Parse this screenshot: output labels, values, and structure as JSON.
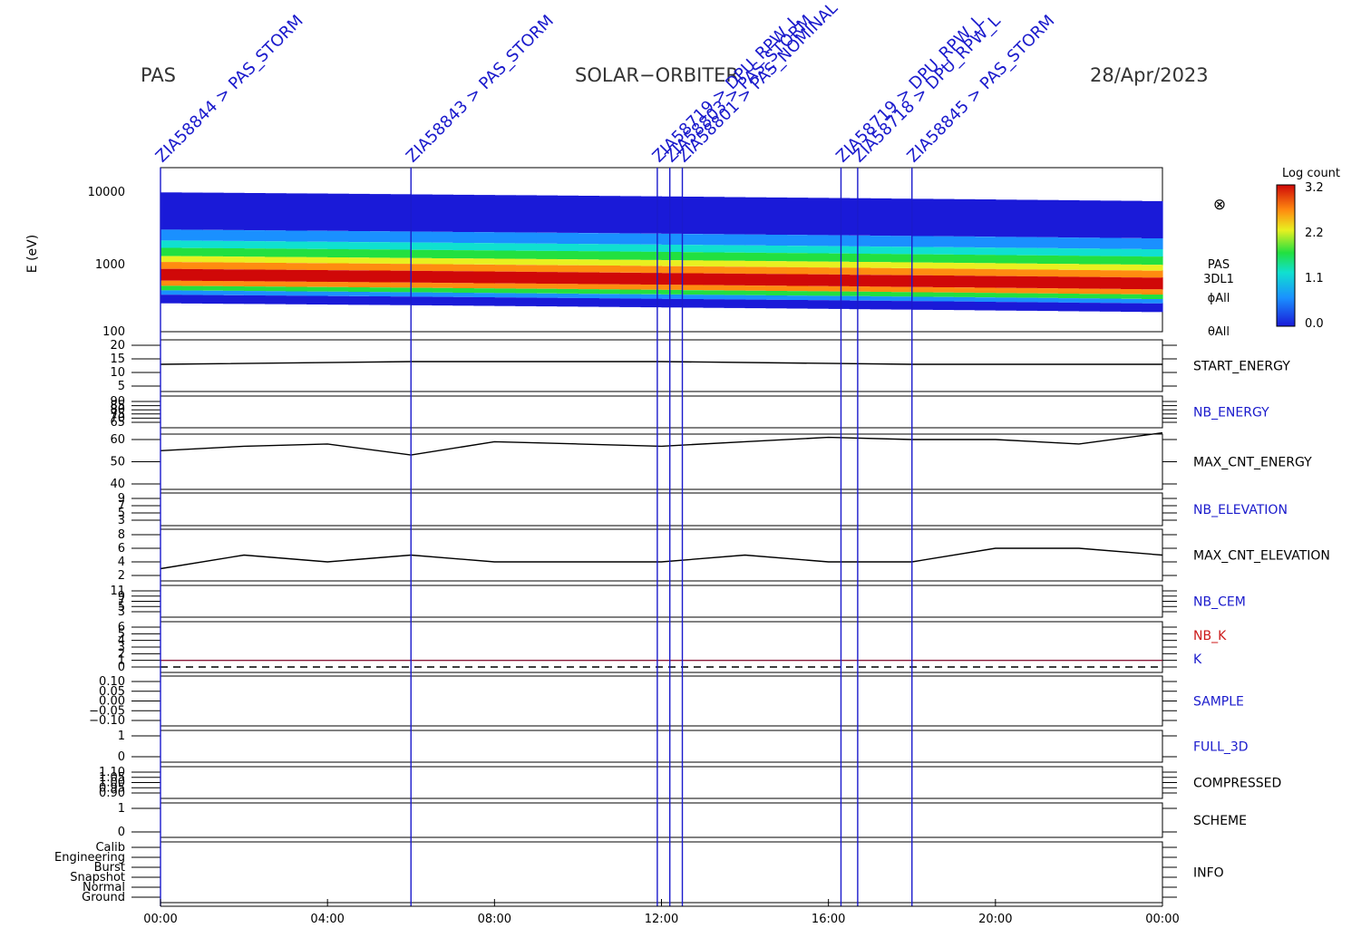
{
  "header": {
    "left": "PAS",
    "center": "SOLAR−ORBITER",
    "right": "28/Apr/2023"
  },
  "colors": {
    "event_line": "#1a1acc",
    "panel_label_blue": "#1a1acc",
    "panel_label_red": "#cc1a1a",
    "k_line": "#8b1a3a"
  },
  "time_axis": {
    "range_hours": [
      0,
      24
    ],
    "ticks": [
      "00:00",
      "04:00",
      "08:00",
      "12:00",
      "16:00",
      "20:00",
      "00:00"
    ]
  },
  "events": {
    "label_prefix": "ZIA58",
    "lines": [
      {
        "t": 0.0,
        "label": "ZIA58844 > PAS_STORM"
      },
      {
        "t": 6.0,
        "label": "ZIA58843 > PAS_STORM"
      },
      {
        "t": 11.9,
        "label": "ZIA58719 > DPU_RPW_L"
      },
      {
        "t": 12.2,
        "label": "ZIA58803 > PAS_STORM"
      },
      {
        "t": 12.5,
        "label": "ZIA58801 > PAS_NOMINAL"
      },
      {
        "t": 16.3,
        "label": "ZIA58719 > DPU_RPW_L"
      },
      {
        "t": 16.7,
        "label": "ZIA58718 > DPU_RPW_L"
      },
      {
        "t": 18.0,
        "label": "ZIA58845 > PAS_STORM"
      }
    ]
  },
  "spectrogram": {
    "ylabel": "E (eV)",
    "yticks": [
      "10000",
      "1000",
      "100"
    ],
    "colorbar": {
      "title": "Log count",
      "ticks": [
        "3.2",
        "2.2",
        "1.1",
        "0.0"
      ]
    },
    "side_labels": [
      "PAS",
      "3DL1",
      "ϕAll",
      "θAll"
    ],
    "symbol": "⊗"
  },
  "panels": [
    {
      "name": "START_ENERGY",
      "color": "black",
      "yticks": [
        "20",
        "15",
        "10",
        "5"
      ]
    },
    {
      "name": "NB_ENERGY",
      "color": "blue",
      "yticks": [
        "90",
        "85",
        "80",
        "75",
        "70",
        "65"
      ]
    },
    {
      "name": "MAX_CNT_ENERGY",
      "color": "black",
      "yticks": [
        "60",
        "50",
        "40"
      ]
    },
    {
      "name": "NB_ELEVATION",
      "color": "blue",
      "yticks": [
        "9",
        "7",
        "5",
        "3"
      ]
    },
    {
      "name": "MAX_CNT_ELEVATION",
      "color": "black",
      "yticks": [
        "8",
        "6",
        "4",
        "2"
      ]
    },
    {
      "name": "NB_CEM",
      "color": "blue",
      "yticks": [
        "11",
        "9",
        "7",
        "5",
        "3"
      ]
    },
    {
      "name": "NB_K",
      "name2": "K",
      "color": "red",
      "color2": "blue",
      "yticks": [
        "6",
        "5",
        "4",
        "3",
        "2",
        "1",
        "0"
      ]
    },
    {
      "name": "SAMPLE",
      "color": "blue",
      "yticks": [
        "0.10",
        "0.05",
        "0.00",
        "−0.05",
        "−0.10"
      ]
    },
    {
      "name": "FULL_3D",
      "color": "blue",
      "yticks": [
        "1",
        "0"
      ]
    },
    {
      "name": "COMPRESSED",
      "color": "black",
      "yticks": [
        "1.10",
        "1.05",
        "1.00",
        "0.95",
        "0.90"
      ]
    },
    {
      "name": "SCHEME",
      "color": "black",
      "yticks": [
        "1",
        "0"
      ]
    },
    {
      "name": "INFO",
      "color": "black",
      "yticks": [
        "Calib",
        "Engineering",
        "Burst",
        "Snapshot",
        "Normal",
        "Ground"
      ]
    }
  ],
  "chart_data": {
    "type": "heatmap",
    "title": "",
    "xlabel": "",
    "ylabel": "E (eV)",
    "ylim": [
      100,
      20000
    ],
    "yscale": "log",
    "x_range": [
      "00:00",
      "00:00"
    ],
    "series": [
      {
        "name": "MAX_CNT_ENERGY",
        "x": [
          0,
          2,
          4,
          6,
          8,
          10,
          12,
          14,
          16,
          18,
          20,
          22,
          24
        ],
        "values": [
          55,
          57,
          58,
          53,
          59,
          58,
          57,
          59,
          61,
          60,
          60,
          58,
          63
        ]
      },
      {
        "name": "MAX_CNT_ELEVATION",
        "x": [
          0,
          2,
          4,
          6,
          8,
          10,
          12,
          14,
          16,
          18,
          20,
          22,
          24
        ],
        "values": [
          3,
          5,
          4,
          5,
          4,
          4,
          4,
          5,
          4,
          4,
          6,
          6,
          5
        ]
      },
      {
        "name": "START_ENERGY",
        "x": [
          0,
          6,
          12,
          18,
          24
        ],
        "values": [
          13,
          14,
          14,
          13,
          13
        ]
      },
      {
        "name": "NB_K",
        "x": [
          0,
          24
        ],
        "values": [
          1,
          1
        ]
      },
      {
        "name": "K",
        "x": [
          0,
          24
        ],
        "values": [
          0,
          0
        ]
      }
    ],
    "peak_energy_ev": [
      650,
      560
    ]
  }
}
